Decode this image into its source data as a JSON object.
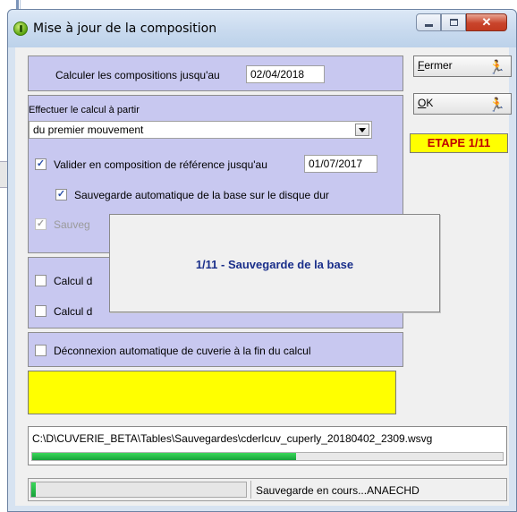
{
  "window": {
    "title": "Mise à jour de la composition"
  },
  "form": {
    "calc_until_label": "Calculer les compositions jusqu'au",
    "calc_until_value": "02/04/2018",
    "calc_from_label": "Effectuer le calcul à partir",
    "calc_from_selected": "du premier mouvement",
    "validate_label": "Valider en composition de référence jusqu'au",
    "validate_date": "01/07/2017",
    "validate_checked": "✓",
    "autosave_label": "Sauvegarde automatique de la base sur le disque dur",
    "autosave_checked": "✓",
    "save_partial_label": "Sauveg",
    "save_partial_checked": "✓",
    "calc1_label": "Calcul d",
    "calc2_label": "Calcul d",
    "disconnect_label": "Déconnexion automatique de cuverie à la fin du calcul"
  },
  "buttons": {
    "close_prefix": "",
    "close_accel": "F",
    "close_rest": "ermer",
    "ok_accel": "O",
    "ok_rest": "K"
  },
  "step_badge": "ETAPE 1/11",
  "overlay": {
    "message": "1/11 - Sauvegarde de la base"
  },
  "path": {
    "text": "C:\\D\\CUVERIE_BETA\\Tables\\Sauvegardes\\cderlcuv_cuperly_20180402_2309.wsvg",
    "progress_fraction": 0.56
  },
  "status": {
    "text": "Sauvegarde en cours...ANAECHD",
    "progress_fraction": 0.02
  },
  "colors": {
    "group_bg": "#c8c8f0",
    "badge_bg": "#ffff00",
    "badge_text": "#c00000",
    "progress": "#17a13a",
    "overlay_text": "#1a2f8a"
  },
  "icons": {
    "app": "app-power-icon",
    "close_button": "running-man-exit-icon",
    "ok_button": "running-man-go-icon"
  }
}
